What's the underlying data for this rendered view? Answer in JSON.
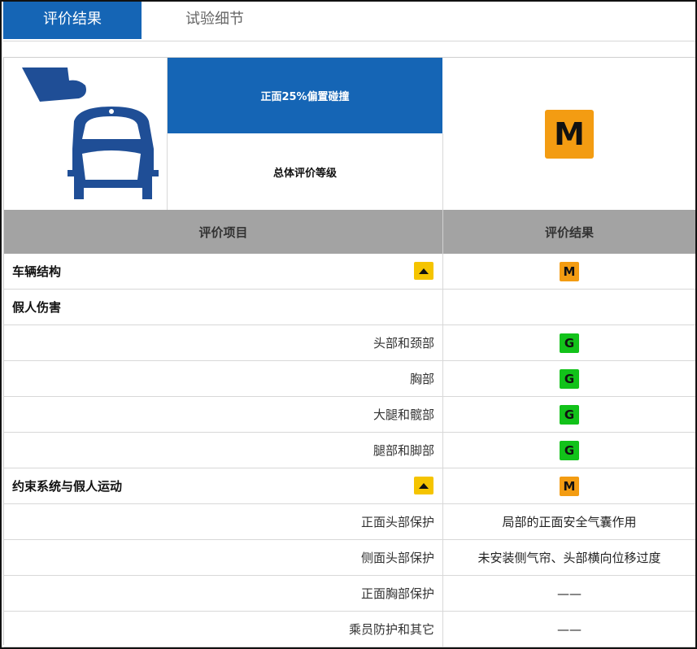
{
  "tabs": [
    {
      "label": "评价结果",
      "active": true
    },
    {
      "label": "试验细节",
      "active": false
    }
  ],
  "test": {
    "type_label": "正面25%偏置碰撞",
    "overall_label": "总体评价等级",
    "overall_rating": "M",
    "overall_rating_color": "#f39c12",
    "icon": "small-overlap-front-crash-icon"
  },
  "table": {
    "headers": [
      "评价项目",
      "评价结果"
    ],
    "rows": [
      {
        "item": "车辆结构",
        "type": "section",
        "rating": "M",
        "rating_color": "orange",
        "collapse_icon": "chevron-up-icon"
      },
      {
        "item": "假人伤害",
        "type": "section",
        "rating": ""
      },
      {
        "item": "头部和颈部",
        "type": "sub",
        "rating": "G",
        "rating_color": "green"
      },
      {
        "item": "胸部",
        "type": "sub",
        "rating": "G",
        "rating_color": "green"
      },
      {
        "item": "大腿和髋部",
        "type": "sub",
        "rating": "G",
        "rating_color": "green"
      },
      {
        "item": "腿部和脚部",
        "type": "sub",
        "rating": "G",
        "rating_color": "green"
      },
      {
        "item": "约束系统与假人运动",
        "type": "section",
        "rating": "M",
        "rating_color": "orange",
        "collapse_icon": "chevron-up-icon"
      },
      {
        "item": "正面头部保护",
        "type": "sub",
        "result": "局部的正面安全气囊作用"
      },
      {
        "item": "侧面头部保护",
        "type": "sub",
        "result": "未安装侧气帘、头部横向位移过度"
      },
      {
        "item": "正面胸部保护",
        "type": "sub",
        "result": "——"
      },
      {
        "item": "乘员防护和其它",
        "type": "sub",
        "result": "——"
      }
    ]
  },
  "colors": {
    "accent_blue": "#1565b5",
    "rating_good": "#12c21a",
    "rating_marginal": "#f39c12",
    "toggle_yellow": "#f5c400",
    "header_gray": "#a3a3a3"
  }
}
